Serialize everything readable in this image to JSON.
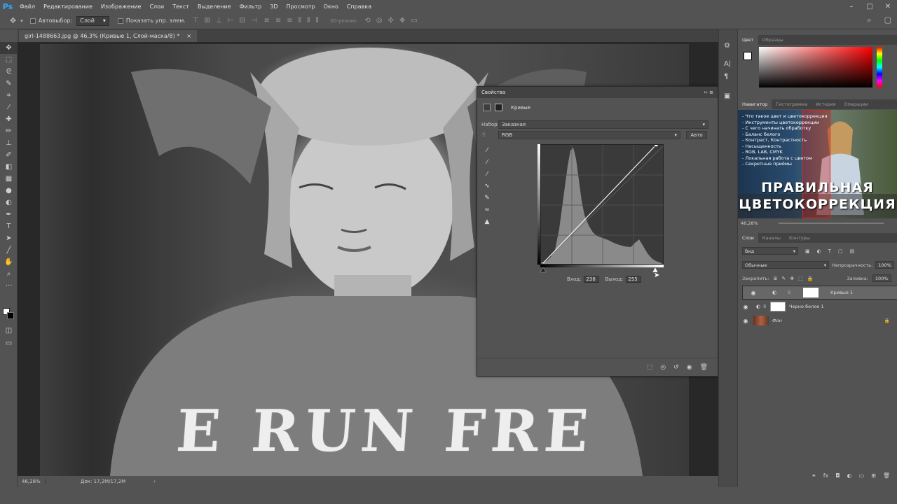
{
  "menu": [
    "Файл",
    "Редактирование",
    "Изображение",
    "Слои",
    "Текст",
    "Выделение",
    "Фильтр",
    "3D",
    "Просмотр",
    "Окно",
    "Справка"
  ],
  "options": {
    "autoselect_label": "Автовыбор:",
    "autoselect_value": "Слой",
    "show_controls_label": "Показать упр. элем.",
    "mode3d": "3D-режим:"
  },
  "document": {
    "tab_title": "girl-1488663.jpg @ 46,3% (Кривые 1, Слой-маска/8) *",
    "close": "×",
    "photo_text": "E RUN FRE"
  },
  "status": {
    "zoom": "46,28%",
    "doc": "Док: 17,2M/17,2M",
    "arrow": "›"
  },
  "properties": {
    "title": "Свойства",
    "subtitle": "Кривые",
    "preset_label": "Набор:",
    "preset_value": "Заказная",
    "channel_value": "RGB",
    "auto_label": "Авто",
    "input_label": "Вход:",
    "input_value": "238",
    "output_label": "Выход:",
    "output_value": "255"
  },
  "chart_data": {
    "type": "line",
    "title": "",
    "xlabel": "",
    "ylabel": "",
    "xlim": [
      0,
      255
    ],
    "ylim": [
      0,
      255
    ],
    "grid": true,
    "series": [
      {
        "x": [
          0,
          238
        ],
        "values": [
          0,
          255
        ]
      }
    ]
  },
  "color_panel": {
    "tabs": [
      "Цвет",
      "Образцы"
    ]
  },
  "navigator": {
    "tabs": [
      "Навигатор",
      "Гистограмма",
      "История",
      "Операции"
    ],
    "list": [
      "- Что такое цвет и цветокоррекция",
      "- Инструменты цветокоррекции",
      "- С чего начинать обработку",
      "- Баланс белого",
      "- Контраст, Контрастность",
      "- Насыщенность",
      "- RGB, LAB, CMYK",
      "- Локальная работа с цветом",
      "- Секретные приёмы"
    ],
    "title1": "ПРАВИЛЬНАЯ",
    "title2": "ЦВЕТОКОРРЕКЦИЯ",
    "zoom": "46,28%"
  },
  "layers": {
    "tabs": [
      "Слои",
      "Каналы",
      "Контуры"
    ],
    "filter": "Вид",
    "blend": "Обычные",
    "opacity_label": "Непрозрачность:",
    "opacity_value": "100%",
    "lock_label": "Закрепить:",
    "fill_label": "Заливка:",
    "fill_value": "100%",
    "items": [
      {
        "name": "Кривые 1"
      },
      {
        "name": "Черно-белое 1"
      },
      {
        "name": "Фон"
      }
    ]
  },
  "colors": {
    "ps_blue": "#31a8ff",
    "panel": "#535353",
    "dark": "#424242"
  }
}
